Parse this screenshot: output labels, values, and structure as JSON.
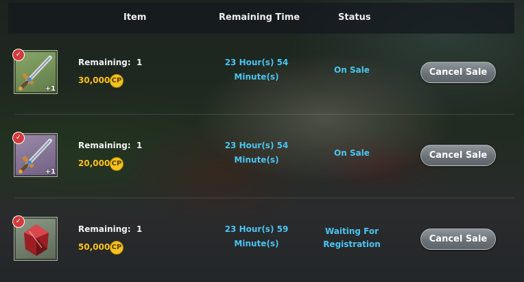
{
  "header": {
    "item_label": "Item",
    "remaining_time_label": "Remaining Time",
    "status_label": "Status"
  },
  "listings": [
    {
      "icon": "sword-icon",
      "remaining_label": "Remaining:",
      "remaining_count": "1",
      "enhance": "+1",
      "price": "30,000",
      "currency": "CP",
      "time_line1": "23 Hour(s) 54",
      "time_line2": "Minute(s)",
      "status_line1": "On Sale",
      "status_line2": "",
      "action": "Cancel Sale"
    },
    {
      "icon": "sword-icon",
      "remaining_label": "Remaining:",
      "remaining_count": "1",
      "enhance": "+1",
      "price": "20,000",
      "currency": "CP",
      "time_line1": "23 Hour(s) 54",
      "time_line2": "Minute(s)",
      "status_line1": "On Sale",
      "status_line2": "",
      "action": "Cancel Sale"
    },
    {
      "icon": "red-gem-icon",
      "remaining_label": "Remaining:",
      "remaining_count": "1",
      "enhance": "",
      "price": "50,000",
      "currency": "CP",
      "time_line1": "23 Hour(s) 59",
      "time_line2": "Minute(s)",
      "status_line1": "Waiting For",
      "status_line2": "Registration",
      "action": "Cancel Sale"
    }
  ],
  "colors": {
    "accent_blue": "#4bc4f2",
    "price_gold": "#ffc21a",
    "check_red": "#d23a3a"
  }
}
